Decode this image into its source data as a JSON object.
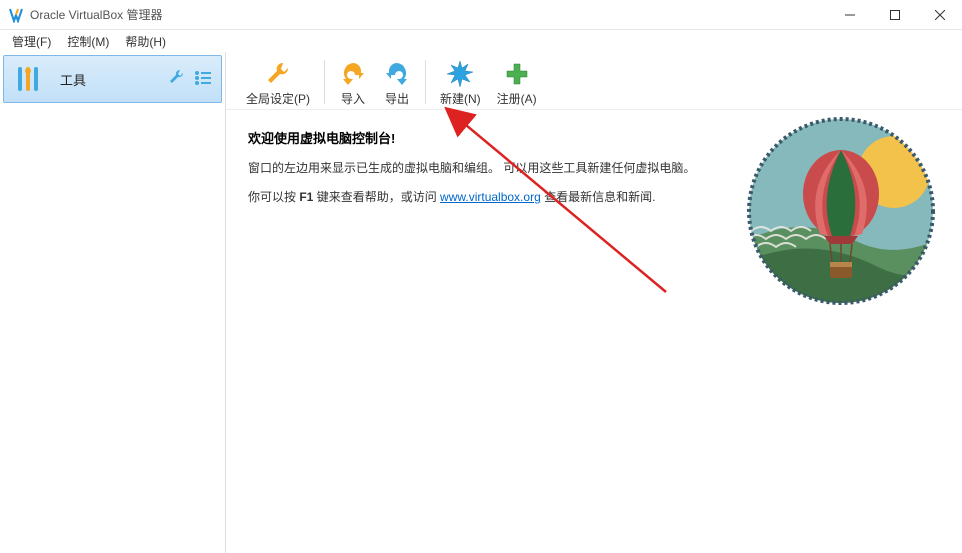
{
  "window": {
    "title": "Oracle VirtualBox 管理器"
  },
  "menu": {
    "file": "管理(F)",
    "control": "控制(M)",
    "help": "帮助(H)"
  },
  "sidebar": {
    "tools_label": "工具"
  },
  "toolbar": {
    "global_settings": "全局设定(P)",
    "import": "导入",
    "export": "导出",
    "new": "新建(N)",
    "add": "注册(A)"
  },
  "welcome": {
    "heading": "欢迎使用虚拟电脑控制台!",
    "line1": "窗口的左边用来显示已生成的虚拟电脑和编组。 可以用这些工具新建任何虚拟电脑。",
    "line2_pre": "你可以按 ",
    "line2_key": "F1",
    "line2_mid": " 键来查看帮助，或访问 ",
    "link_text": "www.virtualbox.org",
    "link_href": "http://www.virtualbox.org",
    "line2_post": " 查看最新信息和新闻."
  }
}
